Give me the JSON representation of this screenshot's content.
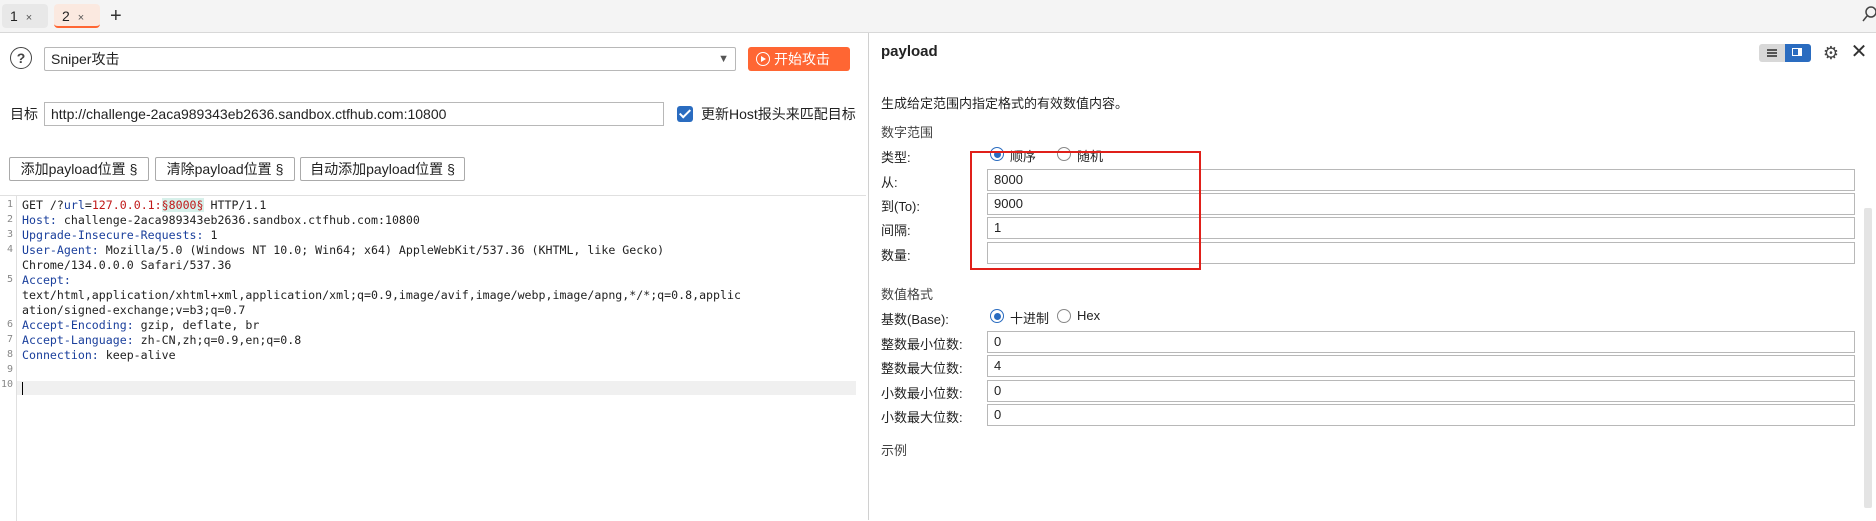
{
  "tabs": [
    {
      "label": "1",
      "close": "×"
    },
    {
      "label": "2",
      "close": "×"
    }
  ],
  "add_tab": "+",
  "toolbar": {
    "help": "?",
    "attack_type": "Sniper攻击",
    "start_label": "开始攻击"
  },
  "target": {
    "label": "目标",
    "url": "http://challenge-2aca989343eb2636.sandbox.ctfhub.com:10800",
    "update_host_label": "更新Host报头来匹配目标",
    "update_host_checked": true
  },
  "position_buttons": [
    "添加payload位置 §",
    "清除payload位置 §",
    "自动添加payload位置 §"
  ],
  "editor": {
    "line_numbers": [
      "1",
      "2",
      "3",
      "4",
      "",
      "5",
      "",
      "",
      "6",
      "7",
      "8",
      "9",
      "10"
    ],
    "l1_a": "GET /?",
    "l1_b": "url",
    "l1_c": "=",
    "l1_d": "127.0.0.1:",
    "l1_e": "§8000§",
    "l1_f": " HTTP/1.1",
    "h2_k": "Host:",
    "h2_v": " challenge-2aca989343eb2636.sandbox.ctfhub.com:10800",
    "h3_k": "Upgrade-Insecure-Requests:",
    "h3_v": " 1",
    "h4_k": "User-Agent:",
    "h4_v": " Mozilla/5.0 (Windows NT 10.0; Win64; x64) AppleWebKit/537.36 (KHTML, like Gecko)",
    "h4_c": "Chrome/134.0.0.0 Safari/537.36",
    "h5_k": "Accept:",
    "h5_c1": "text/html,application/xhtml+xml,application/xml;q=0.9,image/avif,image/webp,image/apng,*/*;q=0.8,applic",
    "h5_c2": "ation/signed-exchange;v=b3;q=0.7",
    "h6_k": "Accept-Encoding:",
    "h6_v": " gzip, deflate, br",
    "h7_k": "Accept-Language:",
    "h7_v": " zh-CN,zh;q=0.9,en;q=0.8",
    "h8_k": "Connection:",
    "h8_v": " keep-alive"
  },
  "payload": {
    "title": "payload",
    "description": "生成给定范围内指定格式的有效数值内容。",
    "range_section": "数字范围",
    "type_label": "类型:",
    "type_options": [
      "顺序",
      "随机"
    ],
    "type_selected": "顺序",
    "from_label": "从:",
    "from_value": "8000",
    "to_label": "到(To):",
    "to_value": "9000",
    "step_label": "间隔:",
    "step_value": "1",
    "count_label": "数量:",
    "count_value": "",
    "format_section": "数值格式",
    "base_label": "基数(Base):",
    "base_options": [
      "十进制",
      "Hex"
    ],
    "base_selected": "十进制",
    "int_min_label": "整数最小位数:",
    "int_min_value": "0",
    "int_max_label": "整数最大位数:",
    "int_max_value": "4",
    "frac_min_label": "小数最小位数:",
    "frac_min_value": "0",
    "frac_max_label": "小数最大位数:",
    "frac_max_value": "0",
    "examples_section": "示例"
  },
  "colors": {
    "accent": "#ff6633",
    "selected": "#2a6cc0",
    "highlight_box": "#e0201a"
  },
  "icons": [
    "help-icon",
    "chevron-down-icon",
    "play-circle-icon",
    "checkbox-icon",
    "list-view-icon",
    "panel-view-icon",
    "gear-icon",
    "close-icon",
    "search-icon"
  ]
}
